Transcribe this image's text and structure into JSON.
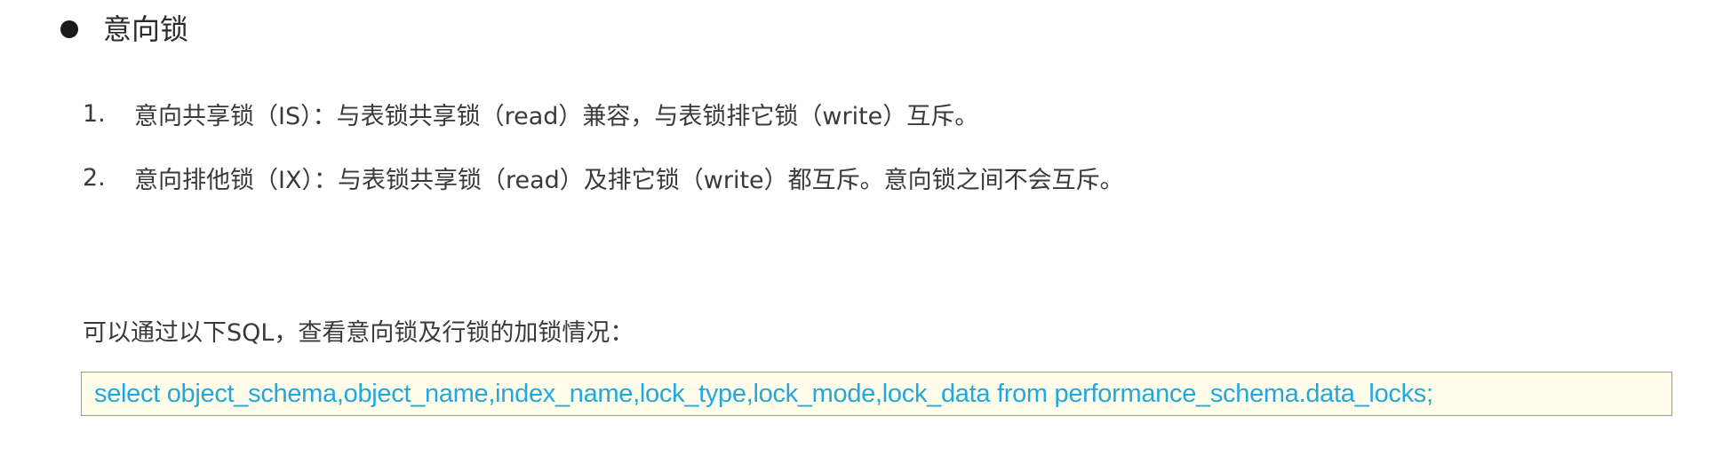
{
  "heading": {
    "title": "意向锁"
  },
  "list": {
    "items": [
      {
        "number": "1.",
        "text": "意向共享锁（IS）：与表锁共享锁（read）兼容，与表锁排它锁（write）互斥。"
      },
      {
        "number": "2.",
        "text": "意向排他锁（IX）：与表锁共享锁（read）及排它锁（write）都互斥。意向锁之间不会互斥。"
      }
    ]
  },
  "note": {
    "text": "可以通过以下SQL，查看意向锁及行锁的加锁情况："
  },
  "code": {
    "sql": "select object_schema,object_name,index_name,lock_type,lock_mode,lock_data from performance_schema.data_locks;"
  },
  "colors": {
    "code_text": "#21a8df",
    "code_background": "#fffdea",
    "body_text": "#3a3a3a"
  }
}
